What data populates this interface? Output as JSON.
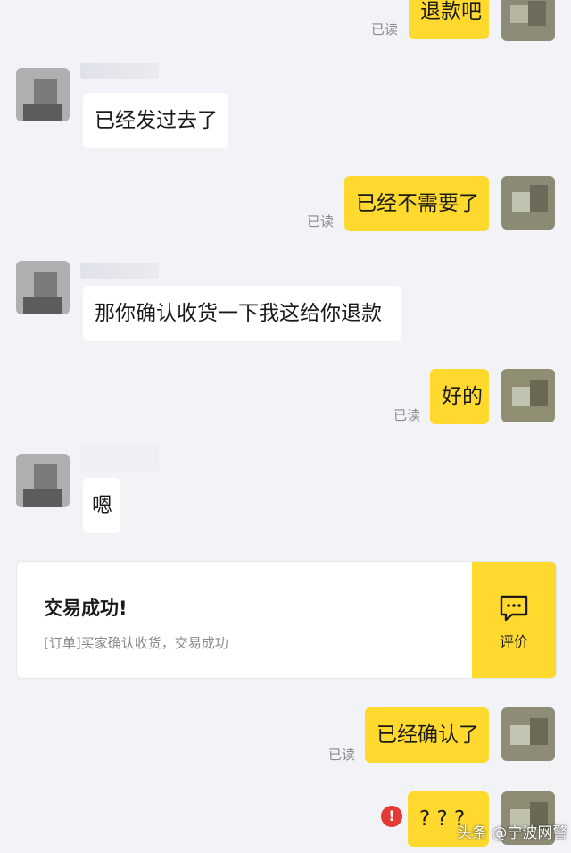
{
  "read_label": "已读",
  "messages": [
    {
      "side": "out",
      "text": "退款吧",
      "read": true
    },
    {
      "side": "in",
      "text": "已经发过去了"
    },
    {
      "side": "out",
      "text": "已经不需要了",
      "read": true
    },
    {
      "side": "in",
      "text": "那你确认收货一下我这给你退款"
    },
    {
      "side": "out",
      "text": "好的",
      "read": true
    },
    {
      "side": "in",
      "text": "嗯"
    },
    {
      "side": "out",
      "text": "已经确认了",
      "read": true
    },
    {
      "side": "out",
      "text": "? ? ?",
      "failed": true
    }
  ],
  "order_card": {
    "title": "交易成功!",
    "description": "[订单]买家确认收货，交易成功",
    "action_label": "评价",
    "action_icon": "chat-bubble-icon"
  },
  "error_icon": {
    "symbol": "!",
    "name": "error-icon"
  },
  "watermark": "头条 @宁波网警",
  "colors": {
    "background": "#f2f3f7",
    "outgoing_bubble": "#ffd92e",
    "incoming_bubble": "#ffffff",
    "error": "#e53935",
    "read_text": "#8a8a8a"
  }
}
